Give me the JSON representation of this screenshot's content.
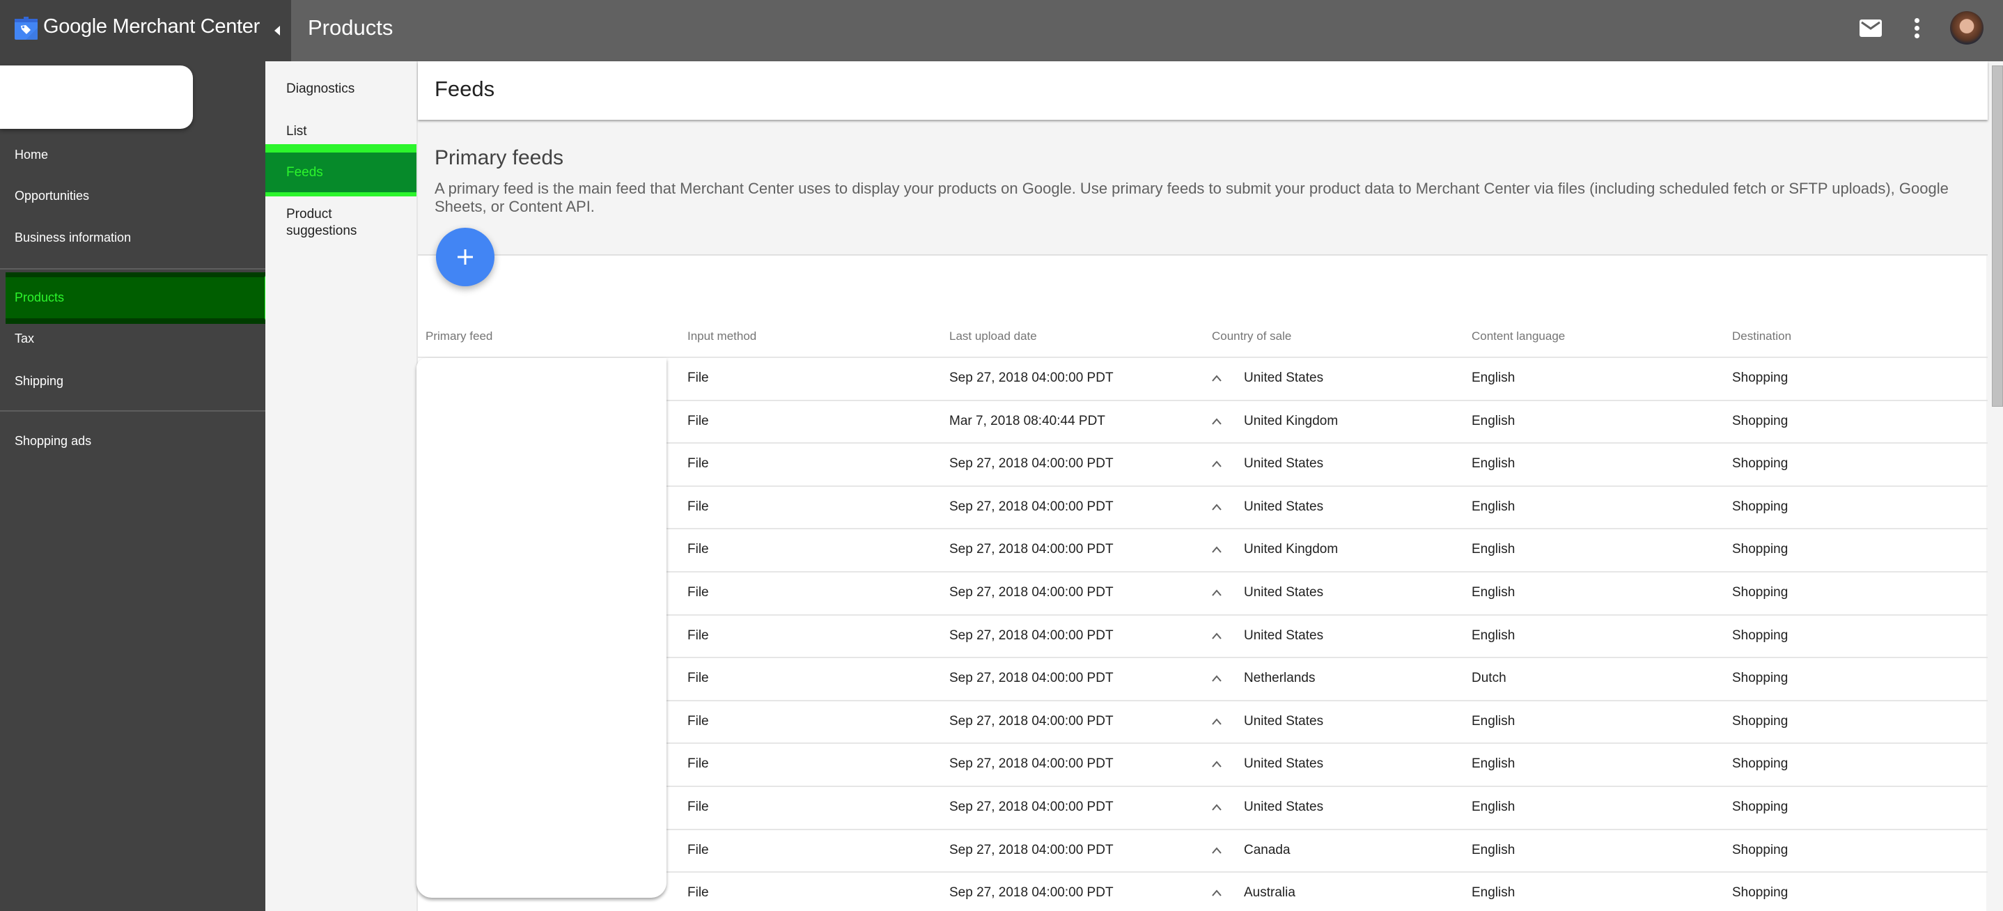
{
  "app": {
    "logo_google": "Google",
    "logo_product": "Merchant Center",
    "page_title": "Products",
    "icons": {
      "logo": "merchant-center-tag-icon",
      "collapse": "caret-left-icon",
      "mail": "mail-icon",
      "more": "more-vert-icon",
      "avatar": "user-avatar"
    }
  },
  "sidebar": {
    "items": [
      {
        "label": "Home"
      },
      {
        "label": "Opportunities"
      },
      {
        "label": "Business information"
      },
      {
        "label": "Products",
        "active": true
      },
      {
        "label": "Tax"
      },
      {
        "label": "Shipping"
      },
      {
        "label": "Shopping ads"
      }
    ]
  },
  "subnav": {
    "items": [
      {
        "label": "Diagnostics"
      },
      {
        "label": "List"
      },
      {
        "label": "Feeds",
        "active": true
      },
      {
        "label": "Product suggestions"
      }
    ]
  },
  "main": {
    "header_title": "Feeds",
    "section_title": "Primary feeds",
    "section_description": "A primary feed is the main feed that Merchant Center uses to display your products on Google. Use primary feeds to submit your product data to Merchant Center via files (including scheduled fetch or SFTP uploads), Google Sheets, or Content API.",
    "add_button_icon": "plus-icon",
    "table": {
      "columns": [
        "Primary feed",
        "Input method",
        "Last upload date",
        "Country of sale",
        "Content language",
        "Destination"
      ],
      "rows": [
        {
          "input": "File",
          "date": "Sep 27, 2018 04:00:00 PDT",
          "country": "United States",
          "language": "English",
          "destination": "Shopping"
        },
        {
          "input": "File",
          "date": "Mar 7, 2018 08:40:44 PDT",
          "country": "United Kingdom",
          "language": "English",
          "destination": "Shopping"
        },
        {
          "input": "File",
          "date": "Sep 27, 2018 04:00:00 PDT",
          "country": "United States",
          "language": "English",
          "destination": "Shopping"
        },
        {
          "input": "File",
          "date": "Sep 27, 2018 04:00:00 PDT",
          "country": "United States",
          "language": "English",
          "destination": "Shopping"
        },
        {
          "input": "File",
          "date": "Sep 27, 2018 04:00:00 PDT",
          "country": "United Kingdom",
          "language": "English",
          "destination": "Shopping"
        },
        {
          "input": "File",
          "date": "Sep 27, 2018 04:00:00 PDT",
          "country": "United States",
          "language": "English",
          "destination": "Shopping"
        },
        {
          "input": "File",
          "date": "Sep 27, 2018 04:00:00 PDT",
          "country": "United States",
          "language": "English",
          "destination": "Shopping"
        },
        {
          "input": "File",
          "date": "Sep 27, 2018 04:00:00 PDT",
          "country": "Netherlands",
          "language": "Dutch",
          "destination": "Shopping"
        },
        {
          "input": "File",
          "date": "Sep 27, 2018 04:00:00 PDT",
          "country": "United States",
          "language": "English",
          "destination": "Shopping"
        },
        {
          "input": "File",
          "date": "Sep 27, 2018 04:00:00 PDT",
          "country": "United States",
          "language": "English",
          "destination": "Shopping"
        },
        {
          "input": "File",
          "date": "Sep 27, 2018 04:00:00 PDT",
          "country": "United States",
          "language": "English",
          "destination": "Shopping"
        },
        {
          "input": "File",
          "date": "Sep 27, 2018 04:00:00 PDT",
          "country": "Canada",
          "language": "English",
          "destination": "Shopping"
        },
        {
          "input": "File",
          "date": "Sep 27, 2018 04:00:00 PDT",
          "country": "Australia",
          "language": "English",
          "destination": "Shopping"
        }
      ]
    }
  },
  "colors": {
    "topbar": "#616161",
    "sidebar": "#424242",
    "active_highlight": "#005e00",
    "active_text": "#2cf52c",
    "fab": "#4285f4"
  }
}
